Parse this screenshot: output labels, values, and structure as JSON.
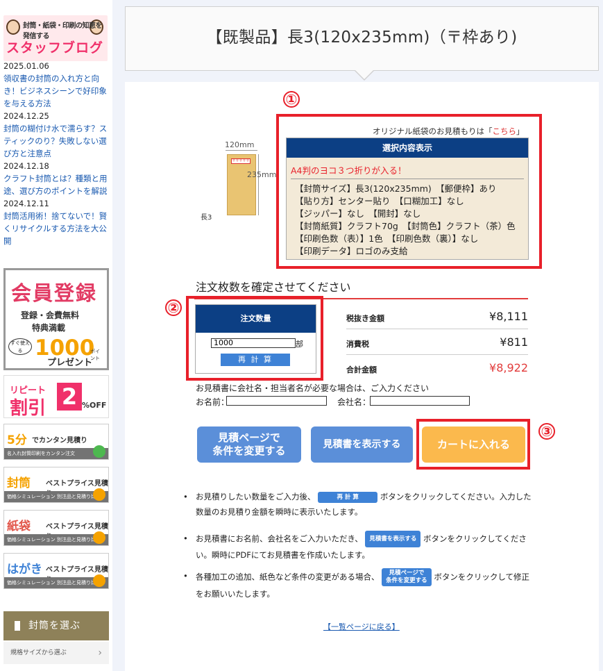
{
  "page": {
    "title": "【既製品】長3(120x235mm)（〒枠あり)"
  },
  "sidebar": {
    "blog_subtitle": "封筒・紙袋・印刷の知恵を発信する",
    "blog_title": "スタッフブログ",
    "posts": [
      {
        "date": "2025.01.06",
        "title": "領収書の封筒の入れ方と向き！ビジネスシーンで好印象を与える方法"
      },
      {
        "date": "2024.12.25",
        "title": "封筒の糊付け水で濡らす？スティックのり？失敗しない選び方と注意点"
      },
      {
        "date": "2024.12.18",
        "title": "クラフト封筒とは？種類と用途、選び方のポイントを解説"
      },
      {
        "date": "2024.12.11",
        "title": "封筒活用術！捨てないで！賢くリサイクルする方法を大公開"
      }
    ],
    "member": {
      "title": "会員登録",
      "line1": "登録・会費無料",
      "line2": "特典満載",
      "badge": "すぐ使える",
      "points": "1000",
      "points_unit": "ポイント",
      "present": "プレゼント"
    },
    "repeat": {
      "top": "リピート",
      "bottom": "割引",
      "number": "2",
      "off": "%OFF"
    },
    "banners": [
      {
        "big": "5分",
        "small": "でカンタン見積り",
        "bar": "名入れ封筒印刷をカンタン注文",
        "color": "#f5a200"
      },
      {
        "big": "封筒",
        "small": "ベストプライス見積り",
        "bar": "価格シミュレーション 別注品と見積り比較",
        "color": "#f5a200"
      },
      {
        "big": "紙袋",
        "small": "ベストプライス見積り",
        "bar": "価格シミュレーション 別注品と見積り比較",
        "color": "#e2564a"
      },
      {
        "big": "はがき",
        "small": "ベストプライス見積り",
        "bar": "価格シミュレーション 別注品と見積り比較",
        "color": "#3e82d6"
      }
    ],
    "choose": "封筒を選ぶ",
    "kikaku": "規格サイズから選ぶ"
  },
  "callouts": {
    "one": "①",
    "two": "②",
    "three": "③"
  },
  "envelope": {
    "width_label": "120mm",
    "height_label": "235mm",
    "name": "長3",
    "stamp_text": "〒〒〒〒〒"
  },
  "original_link": {
    "prefix": "オリジナル紙袋のお見積もりは「",
    "link": "こちら",
    "suffix": "」"
  },
  "selection": {
    "header": "選択内容表示",
    "headline": "A4判のヨコ３つ折りが入る！",
    "lines": [
      "【封筒サイズ】長3(120x235mm)　【郵便枠】あり",
      "【貼り方】センター貼り　【口糊加工】なし",
      "【ジッパー】なし　【開封】なし",
      "【封筒紙質】クラフト70g　【封筒色】クラフト（茶）色",
      "【印刷色数（表）】1色　【印刷色数（裏）】なし",
      "【印刷データ】ロゴのみ支給"
    ]
  },
  "order": {
    "heading": "注文枚数を確定させてください",
    "qty_header": "注文数量",
    "qty_value": "1000",
    "qty_unit": "部",
    "recalc": "再 計 算",
    "prices": [
      {
        "label": "税抜き金額",
        "value": "¥8,111",
        "color": "#222"
      },
      {
        "label": "消費税",
        "value": "¥811",
        "color": "#222"
      },
      {
        "label": "合計金額",
        "value": "¥8,922",
        "color": "#e23b3b"
      }
    ]
  },
  "names": {
    "note": "お見積書に会社名・担当者名が必要な場合は、ご入力ください",
    "name_label": "お名前：",
    "company_label": "会社名："
  },
  "buttons": {
    "change_line1": "見積ページで",
    "change_line2": "条件を変更する",
    "show_quote": "見積書を表示する",
    "add_cart": "カートに入れる"
  },
  "help": {
    "b1_pre": "お見積りしたい数量をご入力後、",
    "b1_btn": "再 計 算",
    "b1_post": "ボタンをクリックしてください。入力した数量のお見積り金額を瞬時に表示いたします。",
    "b2_pre": "お見積書にお名前、会社名をご入力いただき、",
    "b2_btn": "見積書を表示する",
    "b2_post": "ボタンをクリックしてください。瞬時にPDFにてお見積書を作成いたします。",
    "b3_pre": "各種加工の追加、紙色など条件の変更がある場合、",
    "b3_btn1": "見積ページで",
    "b3_btn2": "条件を変更する",
    "b3_post": "ボタンをクリックして修正をお願いいたします。"
  },
  "back_link": "【一覧ページに戻る】"
}
